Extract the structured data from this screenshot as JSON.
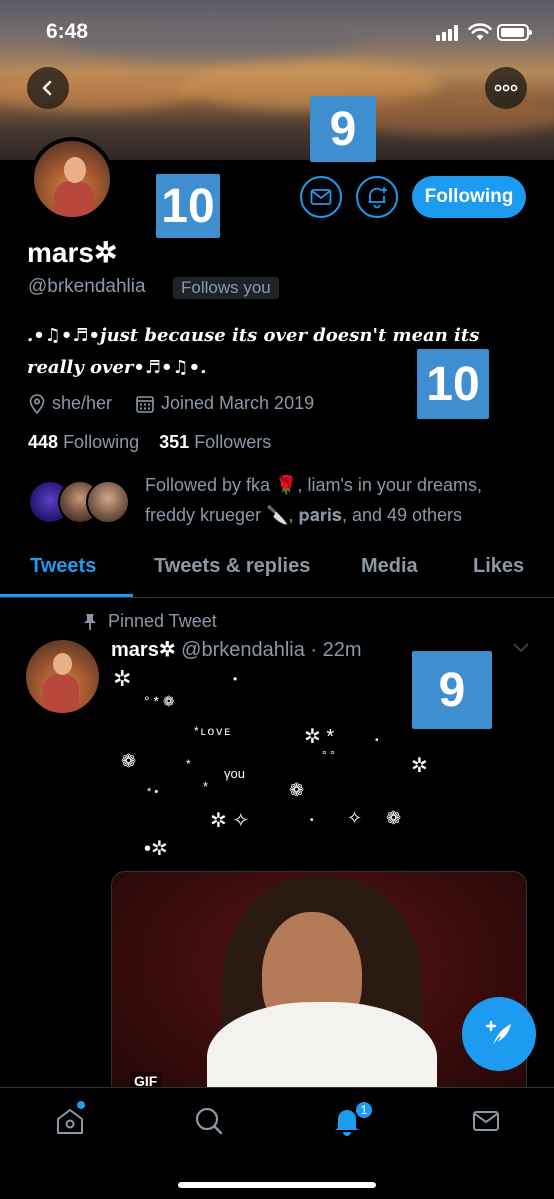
{
  "status_bar": {
    "time": "6:48"
  },
  "profile": {
    "name": "mars✲",
    "handle": "@brkendahlia",
    "follows_you": "Follows you",
    "bio_line1": ".•♫•♬•just because its over doesn't mean its",
    "bio_line2": "really over•♬•♫•.",
    "pronouns": "she/her",
    "joined": "Joined March 2019",
    "following_count": "448",
    "following_label": "Following",
    "followers_count": "351",
    "followers_label": "Followers",
    "followed_by_line1": "Followed by fka 🌹, liam's in your dreams,",
    "followed_by_line2": "freddy krueger 🔪, 𝐩𝐚𝐫𝐢𝐬, and 49 others",
    "follow_button": "Following"
  },
  "overlays": {
    "badge_top": "9",
    "badge_avatar": "10",
    "badge_bio": "10",
    "badge_tweet": "9"
  },
  "tabs": [
    {
      "label": "Tweets",
      "active": true
    },
    {
      "label": "Tweets & replies",
      "active": false
    },
    {
      "label": "Media",
      "active": false
    },
    {
      "label": "Likes",
      "active": false
    }
  ],
  "tweet": {
    "pinned_label": "Pinned Tweet",
    "author": "mars✲",
    "handle_time": "@brkendahlia · 22m",
    "deco_love": "*ʟᴏᴠᴇ",
    "deco_you": "γou",
    "gif_label": "GIF"
  },
  "bottom_nav": {
    "notifications_badge": "1"
  },
  "colors": {
    "accent": "#1d9bf0",
    "badge": "#3e8ed0",
    "muted": "#8b98a5"
  },
  "icons": [
    "back-arrow-icon",
    "more-icon",
    "mail-icon",
    "bell-plus-icon",
    "location-icon",
    "calendar-icon",
    "pin-icon",
    "chevron-down-icon",
    "compose-icon",
    "home-icon",
    "search-icon",
    "bell-icon"
  ]
}
